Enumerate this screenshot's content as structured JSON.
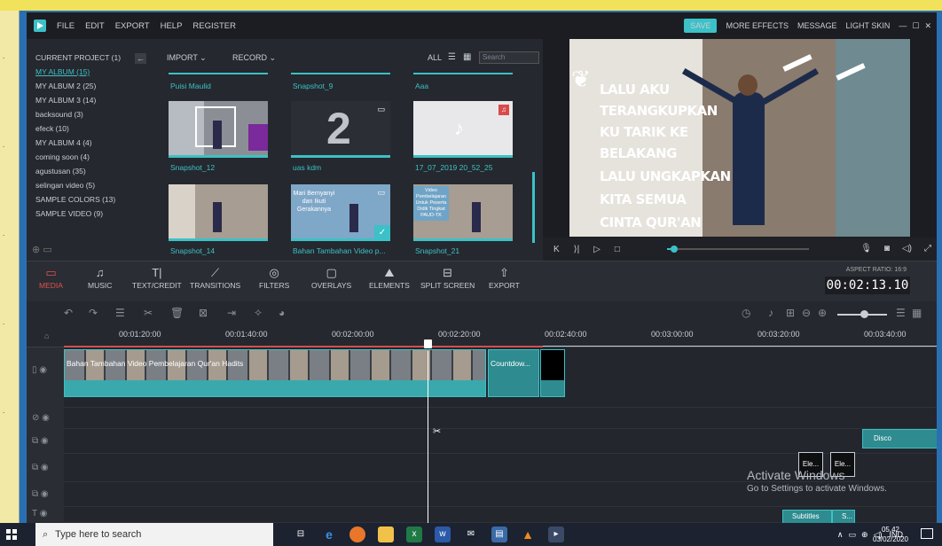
{
  "menubar": {
    "items": [
      "FILE",
      "EDIT",
      "EXPORT",
      "HELP",
      "REGISTER"
    ],
    "save": "SAVE",
    "right_items": [
      "MORE EFFECTS",
      "MESSAGE",
      "LIGHT SKIN"
    ],
    "window_controls": [
      "—",
      "☐",
      "✕"
    ]
  },
  "albums": {
    "current_project": "CURRENT PROJECT (1)",
    "items": [
      "MY ALBUM (15)",
      "MY ALBUM 2 (25)",
      "MY ALBUM 3 (14)",
      "backsound (3)",
      "efeck (10)",
      "MY ALBUM 4 (4)",
      "coming soon (4)",
      "agustusan (35)",
      "selingan video (5)",
      "SAMPLE COLORS (13)",
      "SAMPLE VIDEO (9)"
    ],
    "active_index": 0
  },
  "media_toolbar": {
    "import": "IMPORT ⌄",
    "record": "RECORD ⌄",
    "filter_all": "ALL",
    "search_placeholder": "Search"
  },
  "media_grid": {
    "top_labels": [
      "Puisi Maulid",
      "Snapshot_9",
      "Aaa"
    ],
    "row1_labels": [
      "Snapshot_12",
      "uas kdm",
      "17_07_2019 20_52_25"
    ],
    "row2_labels": [
      "Snapshot_14",
      "Bahan Tambahan Video p...",
      "Snapshot_21"
    ],
    "thumb_big_number": "2",
    "thumb_text_mari": "Mari Bernyanyi dan Ikuti Gerakannya",
    "thumb_text_video": "Video Pembelajaran Untuk Peserta Didik Tingkat PAUD-TK"
  },
  "preview": {
    "lyrics": [
      "LALU AKU",
      "TERANGKUPKAN",
      "KU TARIK KE",
      "BELAKANG",
      "LALU UNGKAPKAN",
      "KITA SEMUA",
      "CINTA QUR'AN"
    ],
    "playback_progress": 0.05
  },
  "toolbar": {
    "tools": [
      "MEDIA",
      "MUSIC",
      "TEXT/CREDIT",
      "TRANSITIONS",
      "FILTERS",
      "OVERLAYS",
      "ELEMENTS",
      "SPLIT SCREEN",
      "EXPORT"
    ],
    "active_index": 0,
    "aspect_ratio": "ASPECT RATIO: 16:9",
    "timecode": "00:02:13.10"
  },
  "timeline": {
    "ticks": [
      "00:01:20:00",
      "00:01:40:00",
      "00:02:00:00",
      "00:02:20:00",
      "00:02:40:00",
      "00:03:00:00",
      "00:03:20:00",
      "00:03:40:00"
    ],
    "main_clip_label": "Bahan Tambahan Video Pembelajaran Qur'an Hadits",
    "countdown_label": "Countdow...",
    "element_labels": [
      "Ele...",
      "Ele..."
    ],
    "disco_label": "Disco",
    "subtitle_labels": [
      "Subtitles",
      "S..."
    ]
  },
  "activation": {
    "title": "Activate Windows",
    "subtitle": "Go to Settings to activate Windows."
  },
  "taskbar": {
    "search_placeholder": "Type here to search",
    "language": "IND",
    "time": "05.42",
    "date": "03/02/2020"
  },
  "colors": {
    "accent": "#3bc1c7",
    "active_tool": "#e0524f",
    "panel_bg": "#23262d"
  }
}
